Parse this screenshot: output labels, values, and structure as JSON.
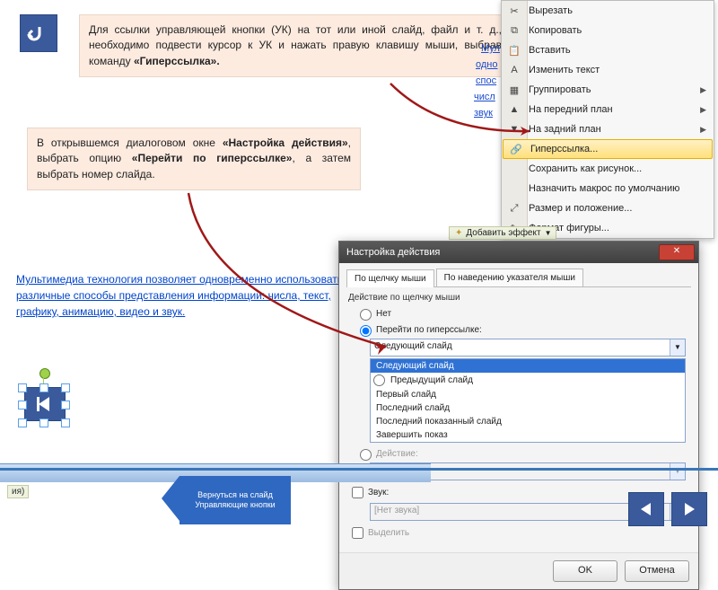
{
  "instr1": "Для ссылки управляющей кнопки (УК) на тот или иной слайд, файл и т. д., необходимо подвести курсор к УК и нажать правую клавишу мыши, выбрав команду ",
  "instr1_bold": "«Гиперссылка».",
  "instr2_a": "В открывшемся диалоговом окне ",
  "instr2_b": "«Настройка действия»",
  "instr2_c": ", выбрать опцию ",
  "instr2_d": "«Перейти по гиперссылке»",
  "instr2_e": ", а затем выбрать номер слайда.",
  "mm_text": "Мультимедиа технология позволяет одновременно использовать различные способы представления информации: числа, текст, графику, анимацию, видео и звук.",
  "partial": {
    "l1": "Мул",
    "l2": "одно",
    "l3": "спос",
    "l4": "числ",
    "l5": "звук"
  },
  "ctx": {
    "cut": "Вырезать",
    "copy": "Копировать",
    "paste": "Вставить",
    "edit": "Изменить текст",
    "group": "Группировать",
    "front": "На передний план",
    "back": "На задний план",
    "hyper": "Гиперссылка...",
    "saveimg": "Сохранить как рисунок...",
    "default": "Назначить макрос по умолчанию",
    "sizepos": "Размер и положение...",
    "format": "Формат фигуры..."
  },
  "addEffect": "Добавить эффект",
  "dlg": {
    "title": "Настройка действия",
    "tab1": "По щелчку мыши",
    "tab2": "По наведению указателя мыши",
    "grp": "Действие по щелчку мыши",
    "r_none": "Нет",
    "r_hyper": "Перейти по гиперссылке:",
    "sel": "Следующий слайд",
    "opts": [
      "Следующий слайд",
      "Предыдущий слайд",
      "Первый слайд",
      "Последний слайд",
      "Последний показанный слайд",
      "Завершить показ"
    ],
    "r_action": "Действие:",
    "r_sound": "Звук:",
    "snd_none": "[Нет звука]",
    "r_highlight": "Выделить",
    "ok": "OK",
    "cancel": "Отмена"
  },
  "hex": "Вернуться на слайд Управляющие кнопки",
  "status": "ия)"
}
